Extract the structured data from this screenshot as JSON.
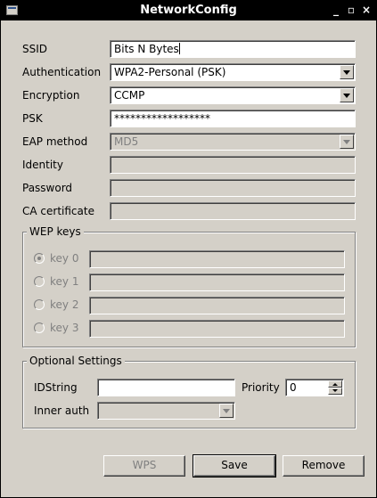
{
  "window": {
    "title": "NetworkConfig",
    "min_glyph": "_",
    "max_glyph": "▫",
    "close_glyph": "×"
  },
  "labels": {
    "ssid": "SSID",
    "authentication": "Authentication",
    "encryption": "Encryption",
    "psk": "PSK",
    "eap_method": "EAP method",
    "identity": "Identity",
    "password": "Password",
    "ca_certificate": "CA certificate"
  },
  "values": {
    "ssid": "Bits N Bytes",
    "authentication": "WPA2-Personal (PSK)",
    "encryption": "CCMP",
    "psk": "******************",
    "eap_method": "MD5",
    "identity": "",
    "password": "",
    "ca_certificate": ""
  },
  "wep": {
    "title": "WEP keys",
    "keys": [
      {
        "label": "key 0",
        "checked": true,
        "value": ""
      },
      {
        "label": "key 1",
        "checked": false,
        "value": ""
      },
      {
        "label": "key 2",
        "checked": false,
        "value": ""
      },
      {
        "label": "key 3",
        "checked": false,
        "value": ""
      }
    ]
  },
  "optional": {
    "title": "Optional Settings",
    "idstring_label": "IDString",
    "idstring_value": "",
    "priority_label": "Priority",
    "priority_value": "0",
    "inner_auth_label": "Inner auth",
    "inner_auth_value": ""
  },
  "buttons": {
    "wps": "WPS",
    "save": "Save",
    "remove": "Remove"
  },
  "colors": {
    "titlebar": "#000000",
    "window_bg": "#d4d0c8",
    "field_bg": "#ffffff",
    "disabled_text": "#808080"
  }
}
